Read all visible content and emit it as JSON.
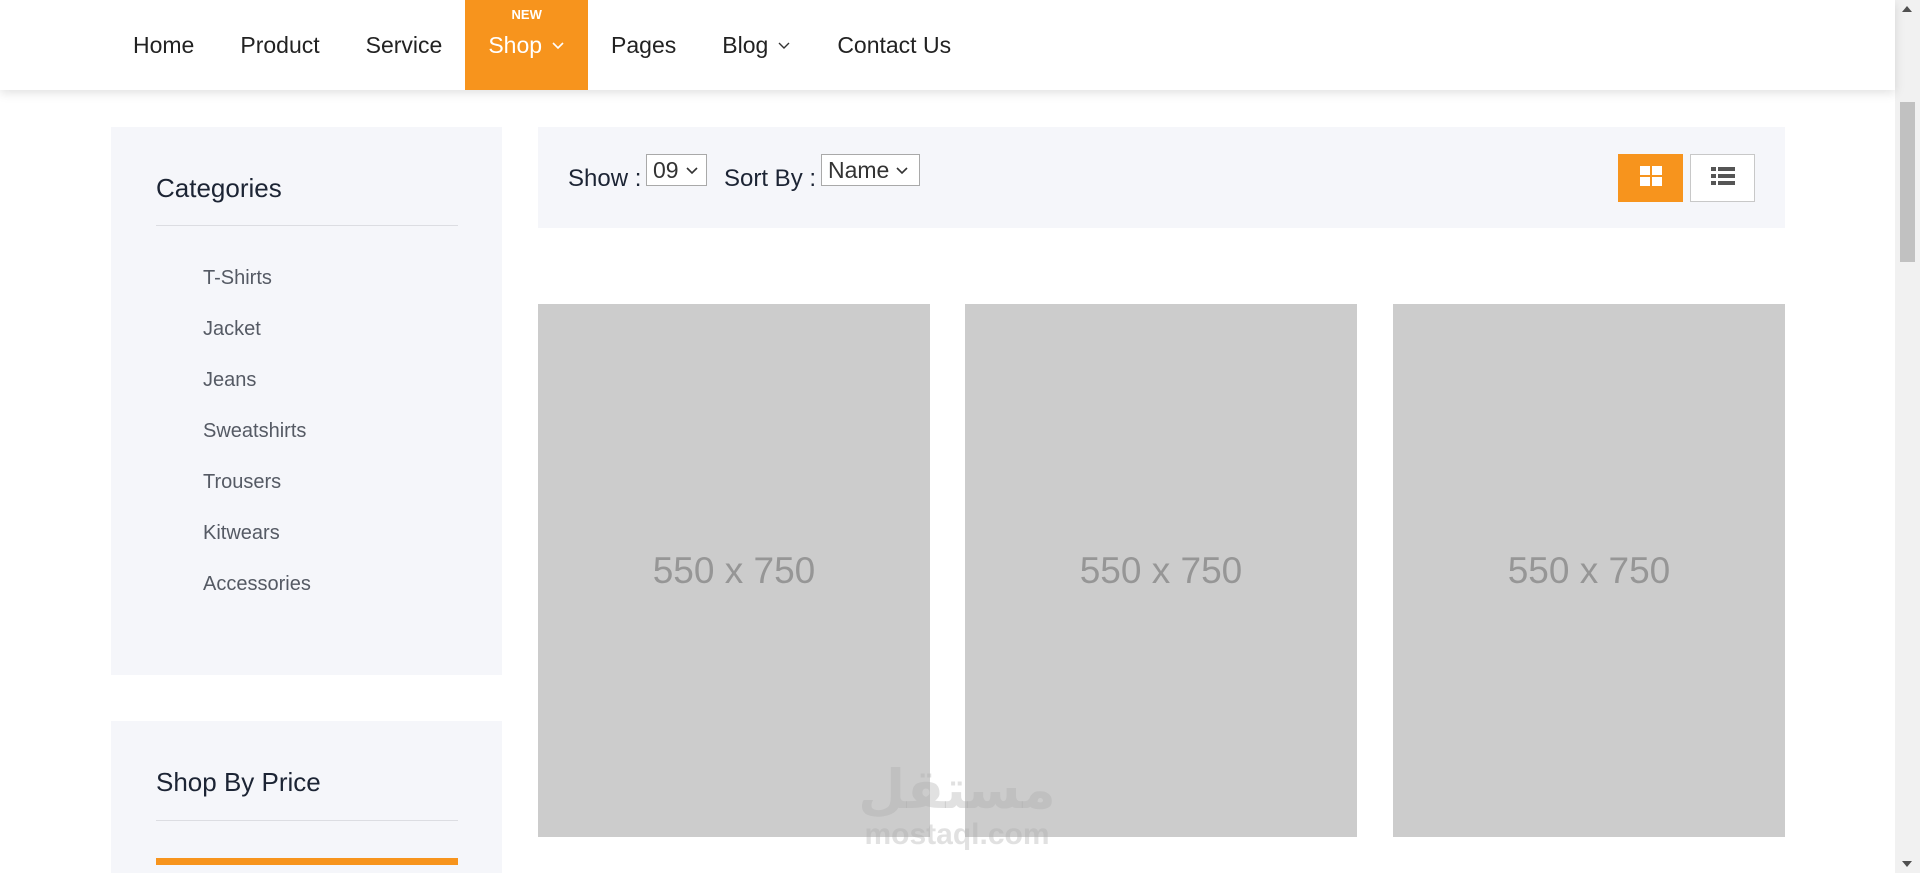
{
  "nav": {
    "items": [
      {
        "label": "Home"
      },
      {
        "label": "Product"
      },
      {
        "label": "Service"
      },
      {
        "label": "Shop",
        "badge": "NEW",
        "active": true
      },
      {
        "label": "Pages"
      },
      {
        "label": "Blog"
      },
      {
        "label": "Contact Us"
      }
    ]
  },
  "sidebar": {
    "categories": {
      "title": "Categories",
      "items": [
        "T-Shirts",
        "Jacket",
        "Jeans",
        "Sweatshirts",
        "Trousers",
        "Kitwears",
        "Accessories"
      ]
    },
    "price": {
      "title": "Shop By Price"
    }
  },
  "toolbar": {
    "show_label": "Show :",
    "show_value": "09",
    "sort_label": "Sort By :",
    "sort_value": "Name"
  },
  "products": [
    {
      "placeholder": "550 x 750"
    },
    {
      "placeholder": "550 x 750"
    },
    {
      "placeholder": "550 x 750"
    }
  ],
  "watermark": {
    "logo_text": "مستقل",
    "text": "mostaql.com"
  },
  "colors": {
    "accent": "#f7941d",
    "panel_bg": "#f5f6fa",
    "placeholder_bg": "#cccccc",
    "placeholder_text": "#969696"
  },
  "icons": {
    "dropdown": "chevron-down-icon",
    "grid_view": "grid-icon",
    "list_view": "list-icon"
  }
}
